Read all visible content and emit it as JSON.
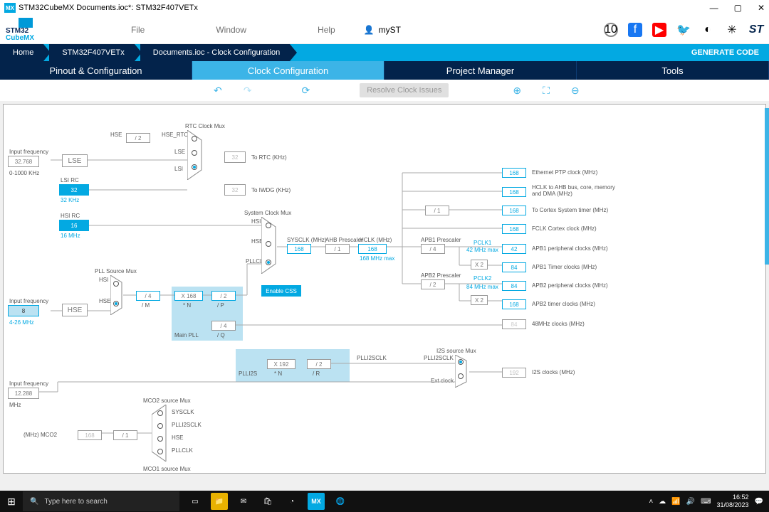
{
  "title": "STM32CubeMX Documents.ioc*: STM32F407VETx",
  "menu": {
    "file": "File",
    "window": "Window",
    "help": "Help",
    "myst": "myST"
  },
  "crumbs": {
    "home": "Home",
    "chip": "STM32F407VETx",
    "doc": "Documents.ioc - Clock Configuration",
    "gen": "GENERATE CODE"
  },
  "tabs": {
    "pinout": "Pinout & Configuration",
    "clock": "Clock Configuration",
    "pm": "Project Manager",
    "tools": "Tools"
  },
  "toolbar": {
    "resolve": "Resolve Clock Issues"
  },
  "d": {
    "inputfreq": "Input frequency",
    "khz_range": "0-1000 KHz",
    "mhz_range": "4-26 MHz",
    "v32768": "32.768",
    "v8": "8",
    "v12288": "12.288",
    "mhz": "MHz",
    "lse": "LSE",
    "lsirc": "LSI RC",
    "lsiv": "32",
    "khz32": "32 KHz",
    "hsirc": "HSI RC",
    "hsiv": "16",
    "mhz16": "16 MHz",
    "hse": "HSE",
    "pllsrc": "PLL Source Mux",
    "hsi": "HSI",
    "hseL": "HSE",
    "div2": "/ 2",
    "div4": "/ 4",
    "div1": "/ 1",
    "x168": "X 168",
    "x192": "X 192",
    "starN": "* N",
    "starM": "/ M",
    "divP": "/ P",
    "divQ": "/ Q",
    "divR": "/ R",
    "mainpll": "Main PLL",
    "plli2s": "PLLI2S",
    "rtcmux": "RTC Clock Mux",
    "hsertc": "HSE_RTC",
    "lseL": "LSE",
    "lsiL": "LSI",
    "tortc": "To RTC (KHz)",
    "toiwdg": "To IWDG (KHz)",
    "v32": "32",
    "sysmux": "System Clock Mux",
    "pllclk": "PLLCLK",
    "enablecss": "Enable CSS",
    "sysclk": "SYSCLK (MHz)",
    "ahbpre": "AHB Prescaler",
    "hclk": "HCLK (MHz)",
    "v168": "168",
    "max168": "168 MHz max",
    "apb1pre": "APB1 Prescaler",
    "apb2pre": "APB2 Prescaler",
    "pclk1": "PCLK1",
    "pclk2": "PCLK2",
    "max42": "42 MHz max",
    "max84": "84 MHz max",
    "x2": "X 2",
    "v42": "42",
    "v84": "84",
    "eth": "Ethernet PTP clock (MHz)",
    "hclkto": "HCLK to AHB bus, core, memory and DMA (MHz)",
    "cortex": "To Cortex System timer (MHz)",
    "fclk": "FCLK Cortex clock (MHz)",
    "apb1p": "APB1 peripheral clocks (MHz)",
    "apb1t": "APB1 Timer clocks (MHz)",
    "apb2p": "APB2 peripheral clocks (MHz)",
    "apb2t": "APB2 timer clocks (MHz)",
    "mhz48": "48MHz clocks (MHz)",
    "i2ssrc": "I2S source Mux",
    "pi2sclk": "PLLI2SCLK",
    "extclk": "Ext clock",
    "v192": "192",
    "i2sclk": "I2S clocks (MHz)",
    "mco2src": "MCO2 source Mux",
    "mco1src": "MCO1 source Mux",
    "mco2o": "(MHz) MCO2",
    "sysclkL": "SYSCLK",
    "plli2sclkL": "PLLI2SCLK",
    "hseL2": "HSE",
    "pllclkL": "PLLCLK"
  },
  "taskbar": {
    "search": "Type here to search",
    "time": "16:52",
    "date": "31/08/2023"
  }
}
